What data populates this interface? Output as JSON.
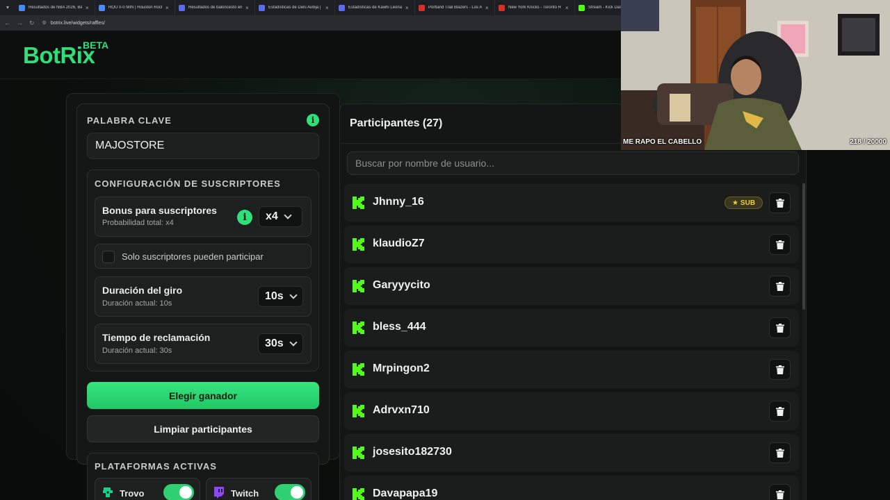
{
  "browser": {
    "tabs": [
      {
        "title": "Resultados de NBA 2026, Bal",
        "color": "#4a8cf7"
      },
      {
        "title": "HOU 0-0 MIN | Houston Rock",
        "color": "#4a8cf7"
      },
      {
        "title": "Resultados de baloncesto en",
        "color": "#5b6cf0"
      },
      {
        "title": "Estadísticas de Deni Avdija |",
        "color": "#5b6cf0"
      },
      {
        "title": "Estadísticas de Kawhi Leonard",
        "color": "#5b6cf0"
      },
      {
        "title": "Portland Trail Blazers - Los A",
        "color": "#d93025"
      },
      {
        "title": "New York Knicks - Toronto R",
        "color": "#d93025"
      },
      {
        "title": "Stream - Kick Dashb",
        "color": "#53fc18"
      }
    ],
    "url": "botrix.live/widgets/raffles/"
  },
  "header": {
    "logo": "BotRix",
    "beta": "BETA"
  },
  "keyword": {
    "label": "PALABRA CLAVE",
    "value": "MAJOSTORE",
    "info_icon": "i"
  },
  "subscribers": {
    "title": "CONFIGURACIÓN DE SUSCRIPTORES",
    "bonus_title": "Bonus para suscriptores",
    "bonus_sub": "Probabilidad total: x4",
    "bonus_value": "x4",
    "only_subs": "Solo suscriptores pueden participar",
    "spin_title": "Duración del giro",
    "spin_sub": "Duración actual: 10s",
    "spin_value": "10s",
    "claim_title": "Tiempo de reclamación",
    "claim_sub": "Duración actual: 30s",
    "claim_value": "30s"
  },
  "actions": {
    "pick_winner": "Elegir ganador",
    "clear": "Limpiar participantes"
  },
  "platforms": {
    "title": "PLATAFORMAS ACTIVAS",
    "items": [
      {
        "name": "Trovo",
        "enabled": true
      },
      {
        "name": "Twitch",
        "enabled": true
      }
    ]
  },
  "participants": {
    "title": "Participantes (27)",
    "search_placeholder": "Buscar por nombre de usuario...",
    "sub_badge": "SUB",
    "list": [
      {
        "name": "Jhnny_16",
        "sub": true
      },
      {
        "name": "klaudioZ7",
        "sub": false
      },
      {
        "name": "Garyyycito",
        "sub": false
      },
      {
        "name": "bless_444",
        "sub": false
      },
      {
        "name": "Mrpingon2",
        "sub": false
      },
      {
        "name": "Adrvxn710",
        "sub": false
      },
      {
        "name": "josesito182730",
        "sub": false
      },
      {
        "name": "Davapapa19",
        "sub": false
      }
    ]
  },
  "webcam": {
    "caption": "ME RAPO EL CABELLO",
    "counter": "218 / 20000"
  },
  "colors": {
    "accent": "#2fe07a",
    "kick": "#53fc18",
    "sub_badge": "#f2cf3c"
  }
}
